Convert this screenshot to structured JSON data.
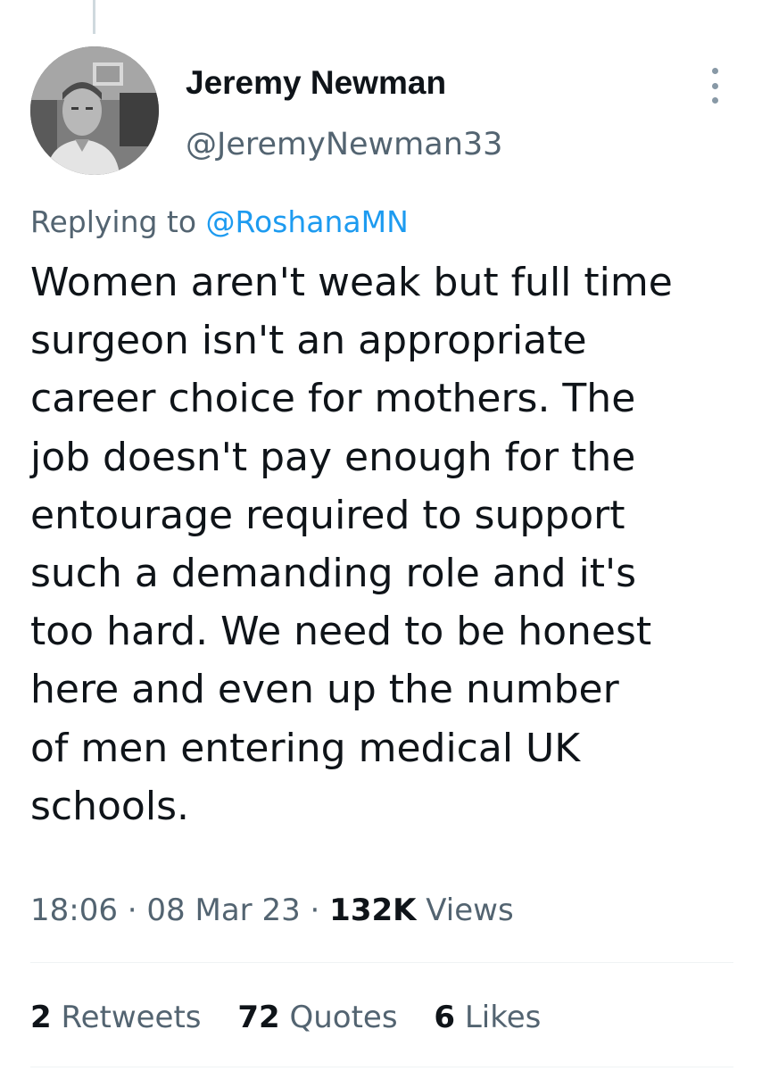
{
  "tweet": {
    "author_name": "Jeremy Newman",
    "author_handle": "@JeremyNewman33",
    "replying_prefix": "Replying to",
    "replying_to": "@RoshanaMN",
    "text_lines": [
      "Women aren't weak but full time",
      "surgeon isn't an appropriate",
      "career choice for mothers. The",
      "job doesn't pay enough for the",
      "entourage required to support",
      "such a demanding role and it's",
      "too hard. We need to be honest",
      "here and even up the number",
      "of men entering medical UK",
      "schools."
    ],
    "time": "18:06",
    "separator": "·",
    "date": "08 Mar 23",
    "views_count": "132K",
    "views_label": "Views"
  },
  "stats": {
    "retweets_count": "2",
    "retweets_label": "Retweets",
    "quotes_count": "72",
    "quotes_label": "Quotes",
    "likes_count": "6",
    "likes_label": "Likes"
  },
  "colors": {
    "text_primary": "#0f1419",
    "text_secondary": "#536471",
    "link": "#1d9bf0",
    "divider": "#eff3f4"
  },
  "icons": {
    "more": "more-vertical-icon",
    "avatar": "user-avatar-photo"
  }
}
